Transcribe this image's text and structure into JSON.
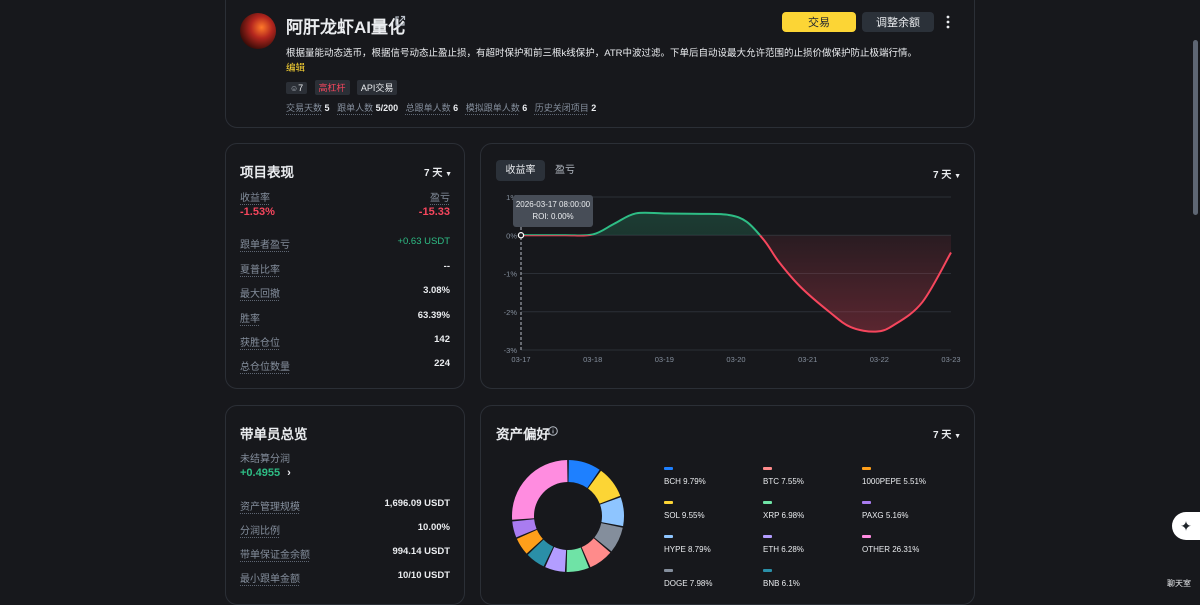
{
  "header": {
    "title": "阿肝龙虾AI量化",
    "description": "根据量能动态选币，根据信号动态止盈止损，有超时保护和前三根k线保护，ATR中波过滤。下单后自动设最大允许范围的止损价做保护防止极端行情。",
    "edit_label": "编辑",
    "tags": {
      "followers": "7",
      "high_leverage": "高杠杆",
      "api": "API交易"
    },
    "stats": [
      {
        "label": "交易天数",
        "value": "5"
      },
      {
        "label": "跟单人数",
        "value": "5/200"
      },
      {
        "label": "总跟单人数",
        "value": "6"
      },
      {
        "label": "模拟跟单人数",
        "value": "6"
      },
      {
        "label": "历史关闭项目",
        "value": "2"
      }
    ],
    "trade_button": "交易",
    "adjust_button": "调整余额",
    "more_icon": "more-vertical-icon",
    "colors": {
      "accent": "#fcd535",
      "negative": "#f6465d",
      "positive": "#2ebd85"
    }
  },
  "performance": {
    "title": "项目表现",
    "period": "7 天",
    "roi_label": "收益率",
    "roi_value": "-1.53%",
    "pnl_label": "盈亏",
    "pnl_value": "-15.33",
    "rows": [
      {
        "label": "跟单者盈亏",
        "value": "+0.63 USDT"
      },
      {
        "label": "夏普比率",
        "value": "--"
      },
      {
        "label": "最大回撤",
        "value": "3.08%"
      },
      {
        "label": "胜率",
        "value": "63.39%"
      },
      {
        "label": "获胜仓位",
        "value": "142"
      },
      {
        "label": "总仓位数量",
        "value": "224"
      }
    ]
  },
  "chart_panel": {
    "tabs": [
      "收益率",
      "盈亏"
    ],
    "period": "7 天",
    "tooltip": {
      "date": "2026-03-17 08:00:00",
      "text": "ROI: 0.00%"
    }
  },
  "chart_data": {
    "type": "area",
    "title": "",
    "xlabel": "",
    "ylabel": "",
    "categories": [
      "03-17",
      "03-18",
      "03-19",
      "03-20",
      "03-21",
      "03-22",
      "03-23"
    ],
    "y_ticks": [
      "1%",
      "0%",
      "-1%",
      "-2%",
      "-3%"
    ],
    "ylim": [
      -3,
      1
    ],
    "series": [
      {
        "values": [
          [
            0,
            0
          ],
          [
            0.6,
            0
          ],
          [
            1,
            0.02
          ],
          [
            1.3,
            0.3
          ],
          [
            1.6,
            0.57
          ],
          [
            2,
            0.57
          ],
          [
            2.5,
            0.56
          ],
          [
            2.9,
            0.53
          ],
          [
            3.15,
            0.35
          ],
          [
            3.4,
            -0.15
          ],
          [
            3.6,
            -0.7
          ],
          [
            3.9,
            -1.35
          ],
          [
            4.3,
            -2.0
          ],
          [
            4.6,
            -2.4
          ],
          [
            4.95,
            -2.52
          ],
          [
            5.2,
            -2.35
          ],
          [
            5.6,
            -1.75
          ],
          [
            6,
            -0.45
          ]
        ]
      }
    ],
    "positive_color": "#2ebd85",
    "negative_color": "#f6465d"
  },
  "lead_trader": {
    "title": "带单员总览",
    "unsettled_label": "未结算分润",
    "unsettled_value": "+0.4955",
    "rows": [
      {
        "label": "资产管理规模",
        "value": "1,696.09 USDT"
      },
      {
        "label": "分润比例",
        "value": "10.00%"
      },
      {
        "label": "带单保证金余额",
        "value": "994.14 USDT"
      },
      {
        "label": "最小跟单金额",
        "value": "10/10 USDT"
      }
    ]
  },
  "assets": {
    "title": "资产偏好",
    "period": "7 天",
    "items": [
      {
        "name": "BCH",
        "pct": "9.79%",
        "value": 9.79,
        "color": "#1e80ff"
      },
      {
        "name": "SOL",
        "pct": "9.55%",
        "value": 9.55,
        "color": "#fcd535"
      },
      {
        "name": "HYPE",
        "pct": "8.79%",
        "value": 8.79,
        "color": "#8ec5ff"
      },
      {
        "name": "DOGE",
        "pct": "7.98%",
        "value": 7.98,
        "color": "#848e9c"
      },
      {
        "name": "BTC",
        "pct": "7.55%",
        "value": 7.55,
        "color": "#ff8b8b"
      },
      {
        "name": "XRP",
        "pct": "6.98%",
        "value": 6.98,
        "color": "#6fe3a6"
      },
      {
        "name": "ETH",
        "pct": "6.28%",
        "value": 6.28,
        "color": "#b39dff"
      },
      {
        "name": "BNB",
        "pct": "6.1%",
        "value": 6.1,
        "color": "#2a8fa8"
      },
      {
        "name": "1000PEPE",
        "pct": "5.51%",
        "value": 5.51,
        "color": "#ff9f1a"
      },
      {
        "name": "PAXG",
        "pct": "5.16%",
        "value": 5.16,
        "color": "#a97cf0"
      },
      {
        "name": "OTHER",
        "pct": "26.31%",
        "value": 26.31,
        "color": "#ff8ce0"
      }
    ]
  },
  "chat_label": "聊天室"
}
